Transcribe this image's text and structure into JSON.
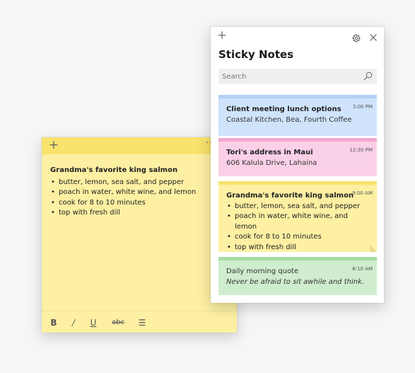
{
  "list_window": {
    "title": "Sticky Notes",
    "search_placeholder": "Search",
    "icons": {
      "add": "plus-icon",
      "settings": "gear-icon",
      "close": "close-icon",
      "search": "search-icon"
    },
    "notes": [
      {
        "color": "#cfe3fb",
        "time": "3:00 PM",
        "title": "Client meeting lunch options",
        "body": "Coastal Kitchen, Bea, Fourth Coffee"
      },
      {
        "color": "#fad0e6",
        "time": "12:30 PM",
        "title": "Tori's address in Maui",
        "body": "606 Kalula Drive, Lahaina"
      },
      {
        "color": "#fdf0a3",
        "time": "9:00 AM",
        "title": "Grandma's favorite king salmon",
        "items": [
          "butter, lemon, sea salt, and pepper",
          "poach in water, white wine, and lemon",
          "cook for 8 to 10 minutes",
          "top with fresh dill"
        ]
      },
      {
        "color": "#cfedce",
        "time": "8:10 AM",
        "title": "Daily morning quote",
        "body": "Never be afraid to sit awhile and think."
      }
    ]
  },
  "note_window": {
    "color": "#fdf0a3",
    "more_label": "··",
    "title": "Grandma's favorite king salmon",
    "items": [
      "butter, lemon, sea salt, and pepper",
      "poach in water, white wine, and lemon",
      "cook for 8 to 10 minutes",
      "top with fresh dill"
    ],
    "format_bar": {
      "bold": "B",
      "italic": "/",
      "underline": "U",
      "strikethrough": "abc",
      "list": "☰"
    }
  }
}
